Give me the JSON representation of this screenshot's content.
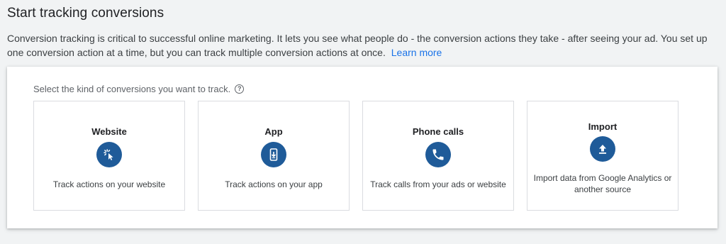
{
  "header": {
    "title": "Start tracking conversions",
    "intro": "Conversion tracking is critical to successful online marketing. It lets you see what people do - the conversion actions they take - after seeing your ad. You set up one conversion action at a time, but you can track multiple conversion actions at once.",
    "learn_more": "Learn more"
  },
  "panel": {
    "prompt": "Select the kind of conversions you want to track.",
    "help_glyph": "?",
    "cards": [
      {
        "title": "Website",
        "icon": "cursor-click-icon",
        "description": "Track actions on your website"
      },
      {
        "title": "App",
        "icon": "mobile-download-icon",
        "description": "Track actions on your app"
      },
      {
        "title": "Phone calls",
        "icon": "phone-icon",
        "description": "Track calls from your ads or website"
      },
      {
        "title": "Import",
        "icon": "upload-icon",
        "description": "Import data from Google Analytics or another source"
      }
    ]
  },
  "colors": {
    "accent": "#1f5b99",
    "link": "#1a73e8",
    "background": "#f1f3f4"
  }
}
